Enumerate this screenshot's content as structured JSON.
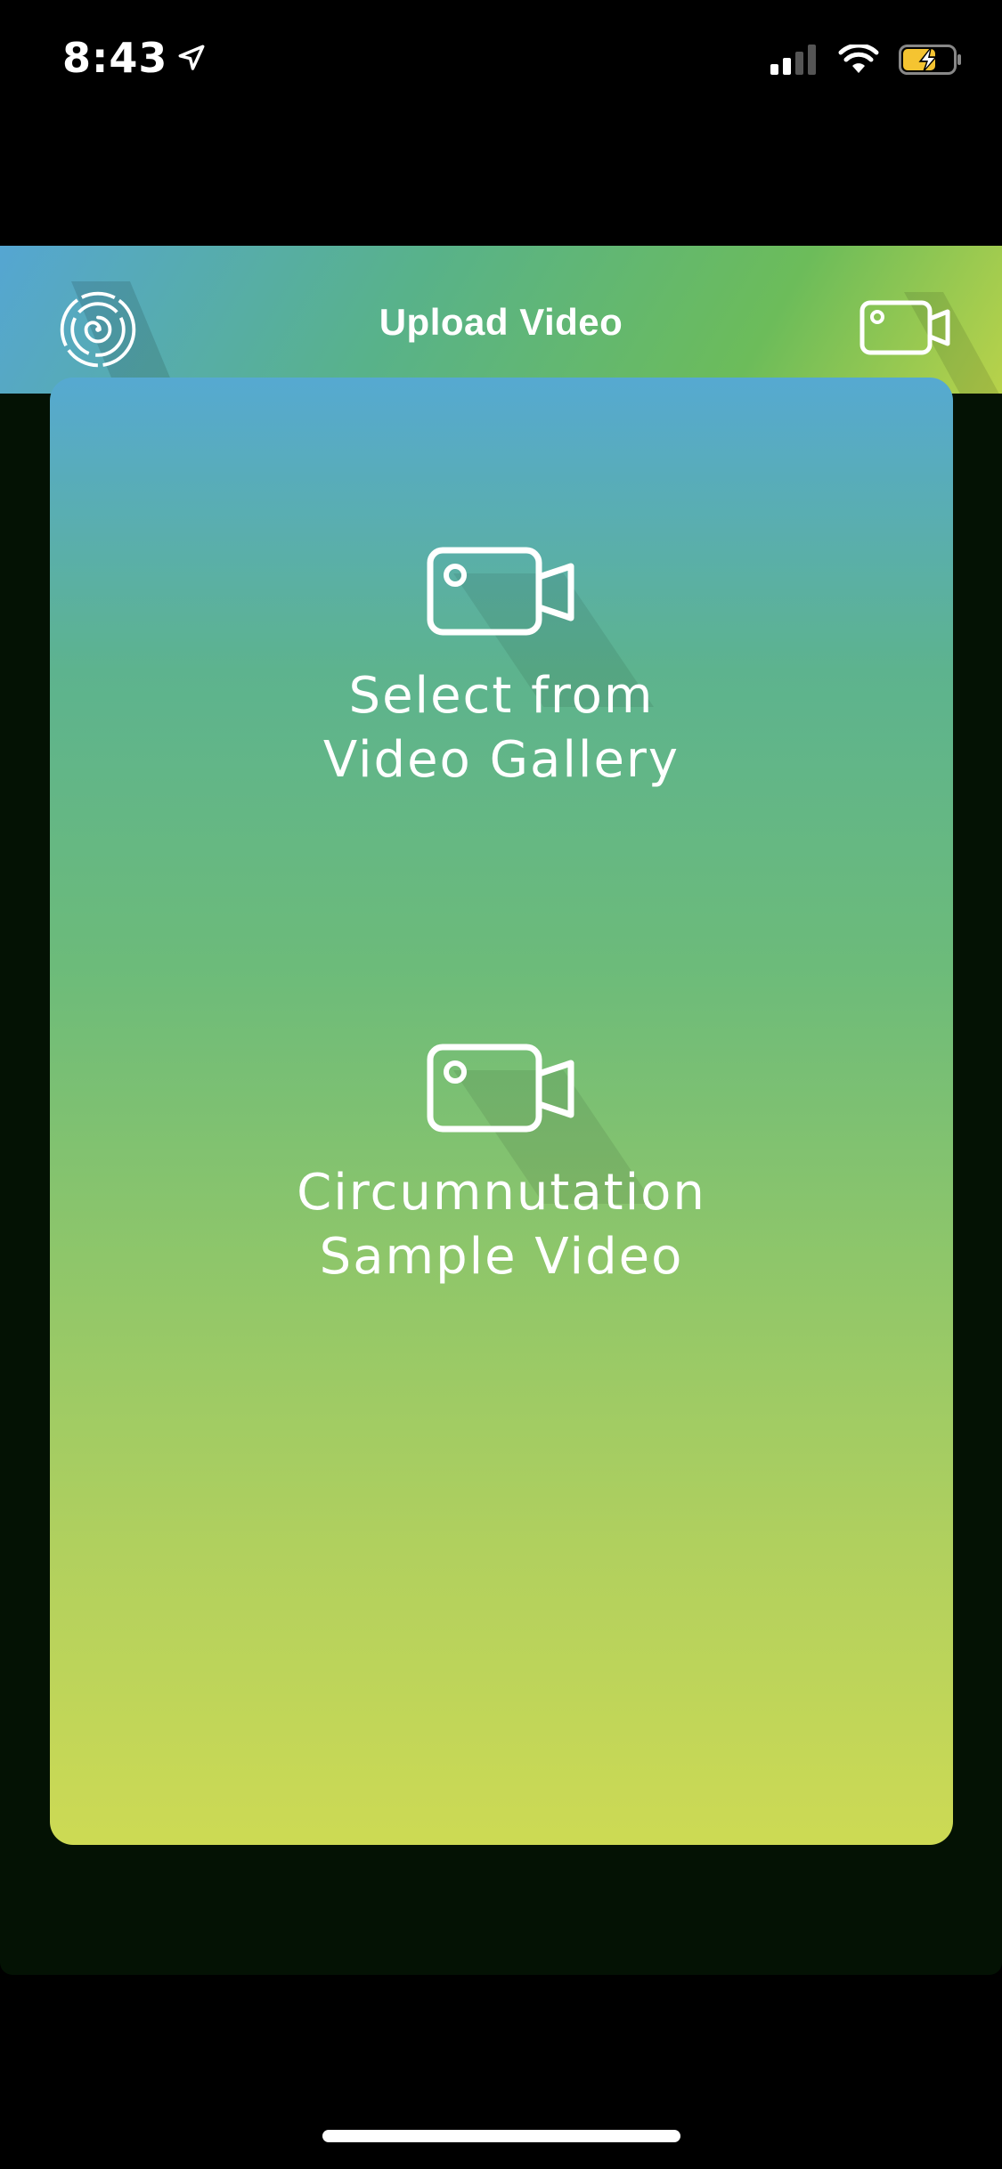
{
  "status_bar": {
    "time": "8:43",
    "icons": [
      "location-arrow-icon",
      "cellular-signal-icon",
      "wifi-icon",
      "battery-charging-icon"
    ],
    "battery_color": "#f5c431"
  },
  "header": {
    "title": "Upload Video",
    "logo_icon": "spiral-logo-icon",
    "action_icon": "video-camera-icon",
    "gradient_colors": [
      "#55a6d2",
      "#58b28a",
      "#6cbc5a",
      "#b8d24a"
    ]
  },
  "card": {
    "gradient_colors": [
      "#56a9d1",
      "#5db38e",
      "#8ec66a",
      "#cdda54"
    ],
    "options": [
      {
        "icon": "video-camera-icon",
        "label": "Select from\nVideo Gallery"
      },
      {
        "icon": "video-camera-icon",
        "label": "Circumnutation\nSample Video"
      }
    ]
  }
}
